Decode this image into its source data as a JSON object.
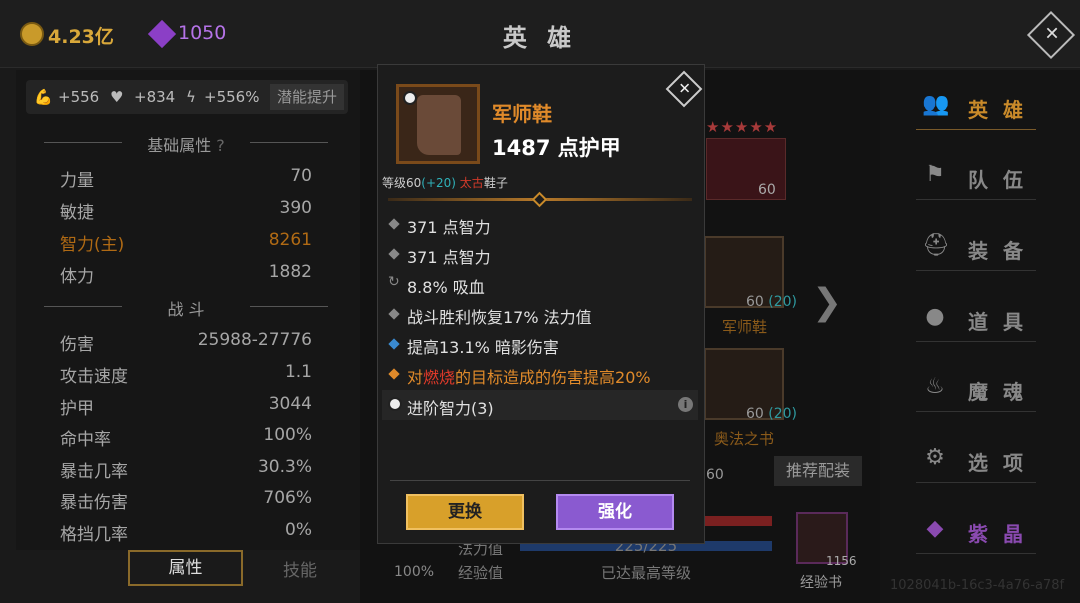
{
  "currency": {
    "gold": "4.23亿",
    "gems": "1050"
  },
  "title": "英 雄",
  "boosts": {
    "strength": "+556",
    "health": "+834",
    "energy": "+556%",
    "button": "潜能提升"
  },
  "sections": {
    "basic": "基础属性",
    "help": "?",
    "battle": "战 斗"
  },
  "basic_stats": [
    {
      "label": "力量",
      "value": "70"
    },
    {
      "label": "敏捷",
      "value": "390"
    },
    {
      "label": "智力(主)",
      "value": "8261"
    },
    {
      "label": "体力",
      "value": "1882"
    }
  ],
  "battle_stats": [
    {
      "label": "伤害",
      "value": "25988-27776"
    },
    {
      "label": "攻击速度",
      "value": "1.1"
    },
    {
      "label": "护甲",
      "value": "3044"
    },
    {
      "label": "命中率",
      "value": "100%"
    },
    {
      "label": "暴击几率",
      "value": "30.3%"
    },
    {
      "label": "暴击伤害",
      "value": "706%"
    },
    {
      "label": "格挡几率",
      "value": "0%"
    }
  ],
  "bottom_tabs": {
    "attributes": "属性",
    "skills": "技能"
  },
  "hero": {
    "level": "60"
  },
  "slots": [
    {
      "lvl": "60",
      "bonus": "(20)",
      "name": "军师鞋"
    },
    {
      "lvl": "60",
      "bonus": "(20)",
      "name": "奥法之书"
    }
  ],
  "partial_num": "60",
  "recommend": "推荐配装",
  "bars": {
    "mana_label": "法力值",
    "mana_value": "225/225",
    "exp_label": "经验值",
    "exp_value": "已达最高等级"
  },
  "percent": "100%",
  "book": {
    "count": "1156",
    "name": "经验书"
  },
  "watermark": "1028041b-16c3-4a76-a78f",
  "nav": [
    "英 雄",
    "队 伍",
    "装 备",
    "道 具",
    "魔 魂",
    "选 项",
    "紫 晶"
  ],
  "item": {
    "name": "军师鞋",
    "main_stat": "1487 点护甲",
    "level_prefix": "等级60",
    "level_bonus": "(+20)",
    "tier": "太古",
    "type": "鞋子",
    "attrs": [
      "371 点智力",
      "371 点智力",
      "8.8% 吸血",
      "战斗胜利恢复17% 法力值",
      "提高13.1% 暗影伤害"
    ],
    "special_pre": "对",
    "special_burn": "燃烧",
    "special_post": "的目标造成的伤害提高20%",
    "advanced": "进阶智力(3)",
    "info": "i",
    "btn_replace": "更换",
    "btn_enhance": "强化"
  },
  "colors": {
    "accent": "#c98a2a",
    "item_name": "#e08a2a",
    "purple": "#8a5ad0",
    "gold_btn": "#d8a02a"
  },
  "icons": [
    "coin-icon",
    "gem-icon",
    "close-icon",
    "muscle-icon",
    "heart-icon",
    "lightning-icon",
    "yin-yang-icon",
    "info-icon",
    "chevron-right-icon",
    "person-icon",
    "flag-icon",
    "helmet-icon",
    "bag-icon",
    "fire-icon",
    "gear-icon",
    "crystal-icon"
  ]
}
